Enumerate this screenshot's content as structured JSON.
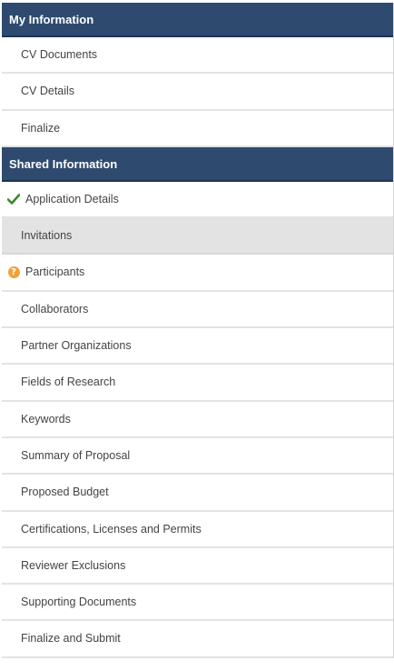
{
  "sections": [
    {
      "title": "My Information",
      "items": [
        {
          "label": "CV Documents",
          "status": ""
        },
        {
          "label": "CV Details",
          "status": ""
        },
        {
          "label": "Finalize",
          "status": ""
        }
      ]
    },
    {
      "title": "Shared Information",
      "items": [
        {
          "label": "Application Details",
          "status": "check-icon"
        },
        {
          "label": "Invitations",
          "status": "",
          "selected": true
        },
        {
          "label": "Participants",
          "status": "warning-icon"
        },
        {
          "label": "Collaborators",
          "status": ""
        },
        {
          "label": "Partner Organizations",
          "status": ""
        },
        {
          "label": "Fields of Research",
          "status": ""
        },
        {
          "label": "Keywords",
          "status": ""
        },
        {
          "label": "Summary of Proposal",
          "status": ""
        },
        {
          "label": "Proposed Budget",
          "status": ""
        },
        {
          "label": "Certifications, Licenses and Permits",
          "status": ""
        },
        {
          "label": "Reviewer Exclusions",
          "status": ""
        },
        {
          "label": "Supporting Documents",
          "status": ""
        },
        {
          "label": "Finalize and Submit",
          "status": ""
        }
      ]
    }
  ],
  "colors": {
    "header_bg": "#2e4a6f",
    "check": "#3a8a2a",
    "warning": "#f0a13a",
    "selected_bg": "#e3e3e3"
  },
  "warning_glyph": "?"
}
